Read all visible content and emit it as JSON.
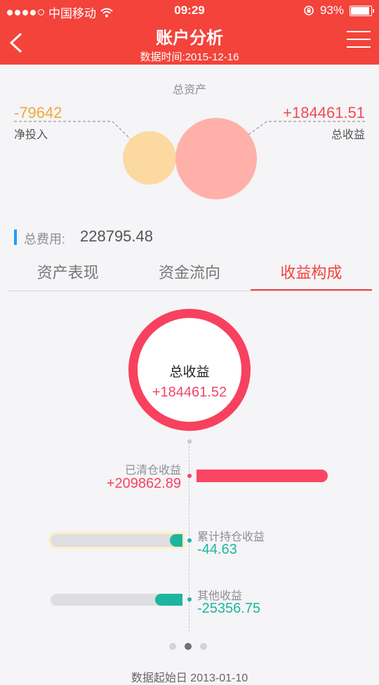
{
  "status_bar": {
    "carrier": "中国移动",
    "time": "09:29",
    "battery": "93%"
  },
  "header": {
    "title": "账户分析",
    "subtitle": "数据时间:2015-12-16"
  },
  "summary": {
    "title": "总资产",
    "net_investment": {
      "value": "-79642",
      "label": "净投入"
    },
    "total_profit": {
      "value": "+184461.51",
      "label": "总收益"
    }
  },
  "fees": {
    "label": "总费用:",
    "value": "228795.48"
  },
  "tabs": [
    {
      "label": "资产表现",
      "active": false
    },
    {
      "label": "资金流向",
      "active": false
    },
    {
      "label": "收益构成",
      "active": true
    }
  ],
  "ring": {
    "title": "总收益",
    "value": "+184461.52"
  },
  "breakdown": [
    {
      "label": "已清仓收益",
      "value": "+209862.89",
      "color": "#f7415f"
    },
    {
      "label": "累计持仓收益",
      "value": "-44.63",
      "color": "#1db59d"
    },
    {
      "label": "其他收益",
      "value": "-25356.75",
      "color": "#1db59d"
    }
  ],
  "pager": {
    "count": 3,
    "active": 1
  },
  "footer": {
    "text": "数据起始日 2013-01-10"
  },
  "colors": {
    "header": "#f3433b",
    "positive": "#f7415f",
    "negative": "#1db59d",
    "accent": "#1f9ff2"
  }
}
